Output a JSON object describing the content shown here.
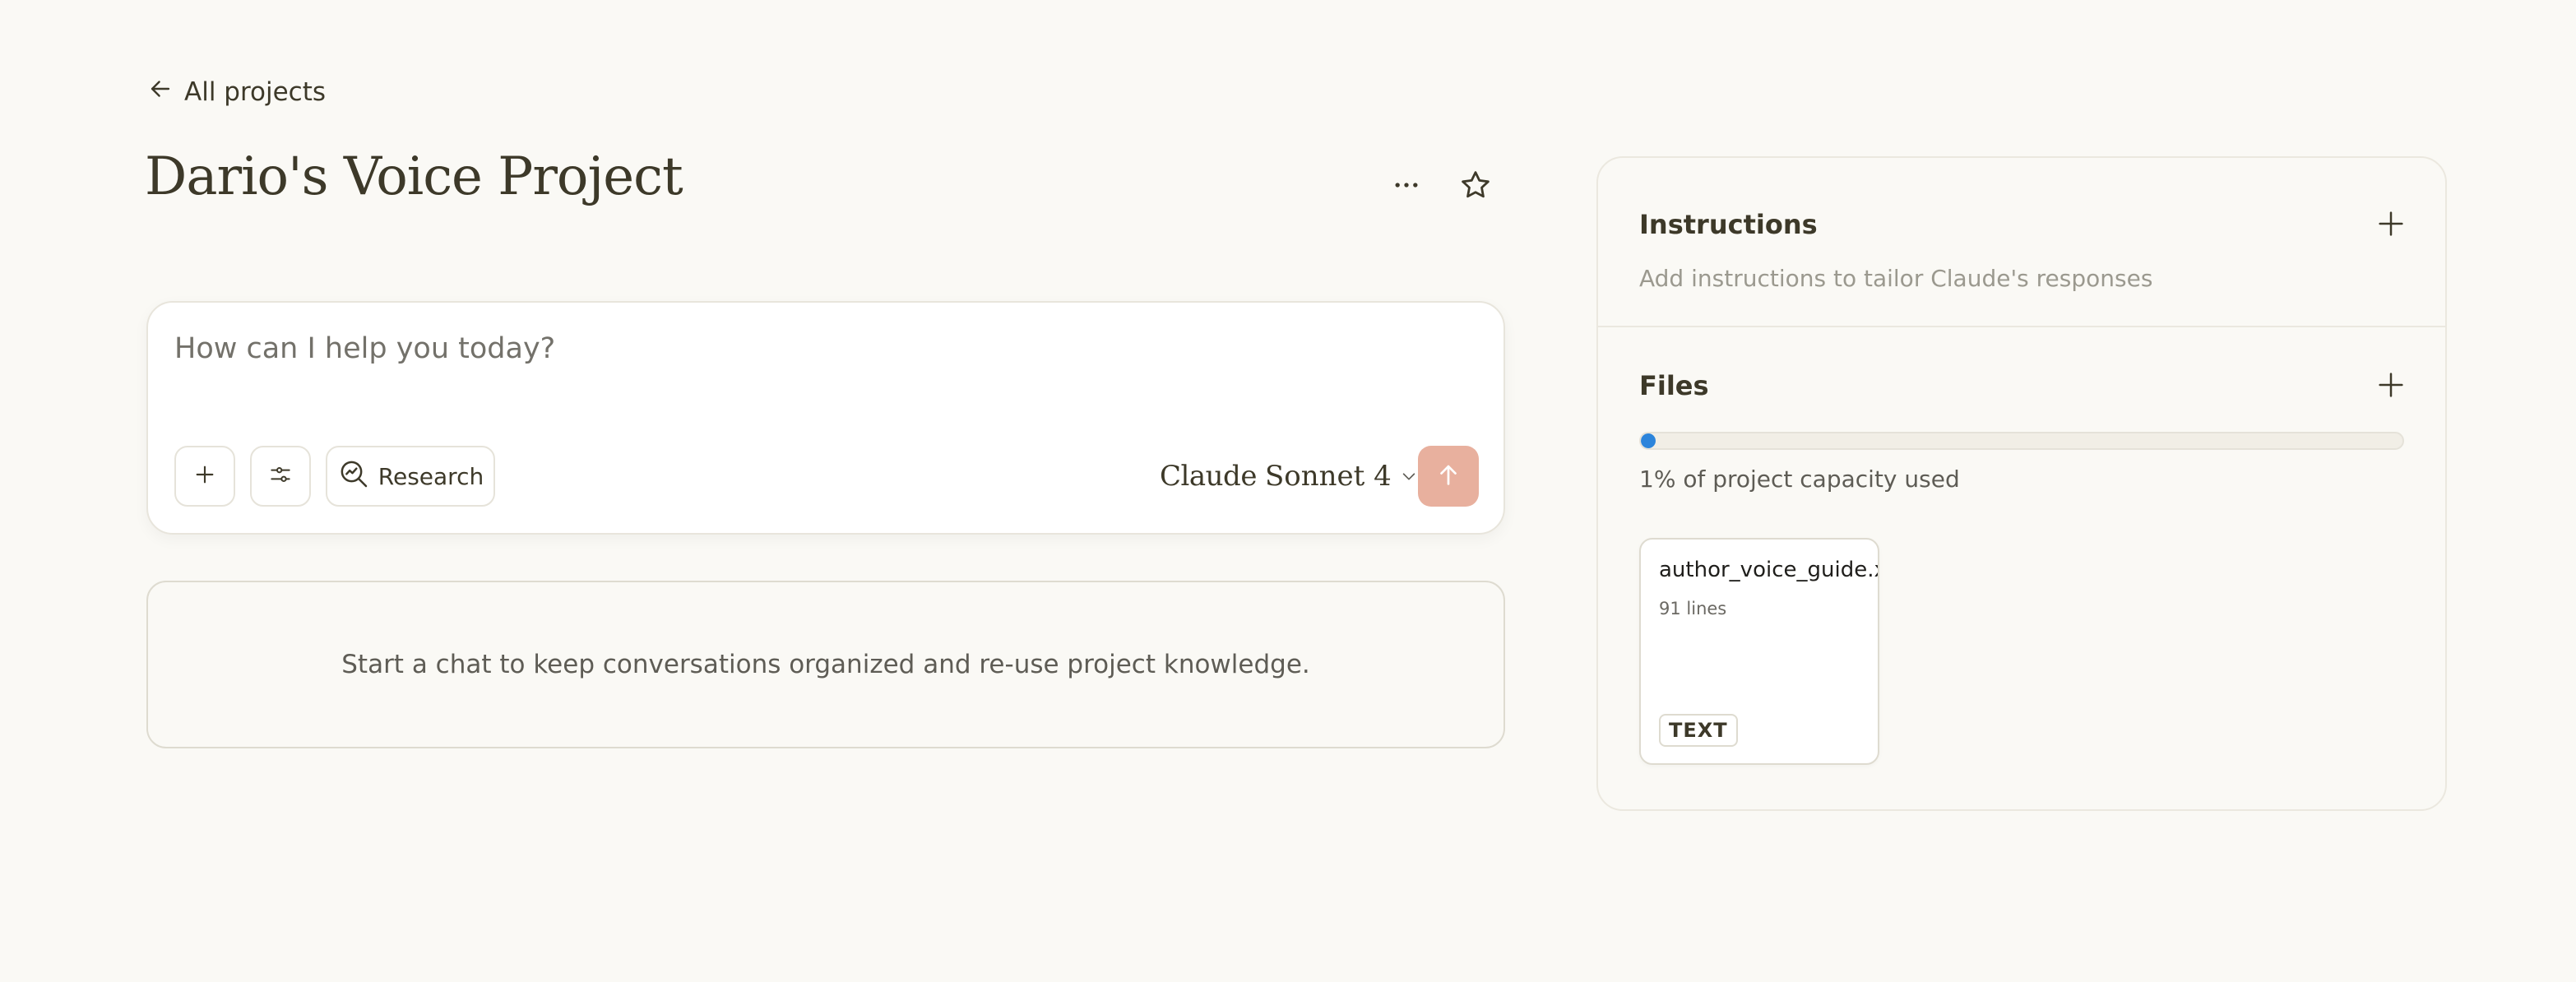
{
  "nav": {
    "back_label": "All projects"
  },
  "project": {
    "title": "Dario's Voice Project"
  },
  "chat": {
    "placeholder": "How can I help you today?",
    "research_label": "Research",
    "model_brand": "Claude",
    "model_name": "Sonnet 4",
    "empty_message": "Start a chat to keep conversations organized and re-use project knowledge."
  },
  "instructions": {
    "title": "Instructions",
    "description": "Add instructions to tailor Claude's responses"
  },
  "files": {
    "title": "Files",
    "capacity_percent": 1,
    "capacity_text": "1% of project capacity used",
    "items": [
      {
        "name": "author_voice_guide.x",
        "meta": "91 lines",
        "type": "TEXT"
      }
    ]
  },
  "colors": {
    "background": "#faf9f5",
    "send_button": "#e8b09e",
    "capacity_fill": "#2c84db",
    "text_primary": "#3d3929"
  },
  "icons": {
    "back": "arrow-left-icon",
    "more": "ellipsis-icon",
    "star": "star-icon",
    "add": "plus-icon",
    "settings": "sliders-icon",
    "research": "magnifier-chart-icon",
    "model_dropdown": "chevron-down-icon",
    "send": "arrow-up-icon"
  }
}
